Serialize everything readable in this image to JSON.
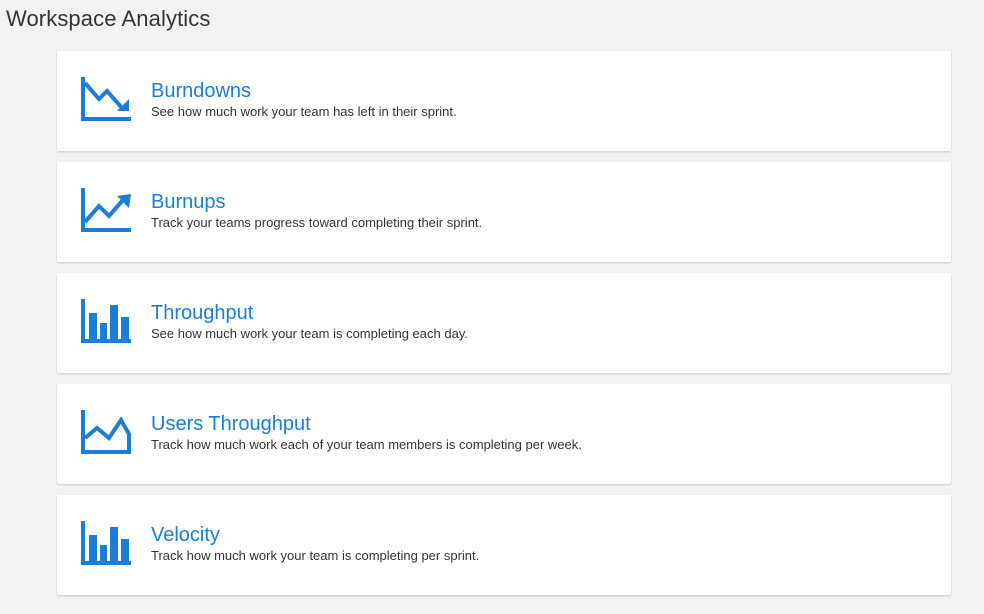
{
  "page": {
    "title": "Workspace Analytics"
  },
  "colors": {
    "accent": "#1a7dd7",
    "background": "#f3f3f3",
    "card": "#ffffff",
    "text": "#333333"
  },
  "cards": [
    {
      "title": "Burndowns",
      "description": "See how much work your team has left in their sprint.",
      "icon": "burndown-chart-icon"
    },
    {
      "title": "Burnups",
      "description": "Track your teams progress toward completing their sprint.",
      "icon": "burnup-chart-icon"
    },
    {
      "title": "Throughput",
      "description": "See how much work your team is completing each day.",
      "icon": "bar-chart-icon"
    },
    {
      "title": "Users Throughput",
      "description": "Track how much work each of your team members is completing per week.",
      "icon": "area-chart-icon"
    },
    {
      "title": "Velocity",
      "description": "Track how much work your team is completing per sprint.",
      "icon": "bar-chart-icon"
    }
  ]
}
